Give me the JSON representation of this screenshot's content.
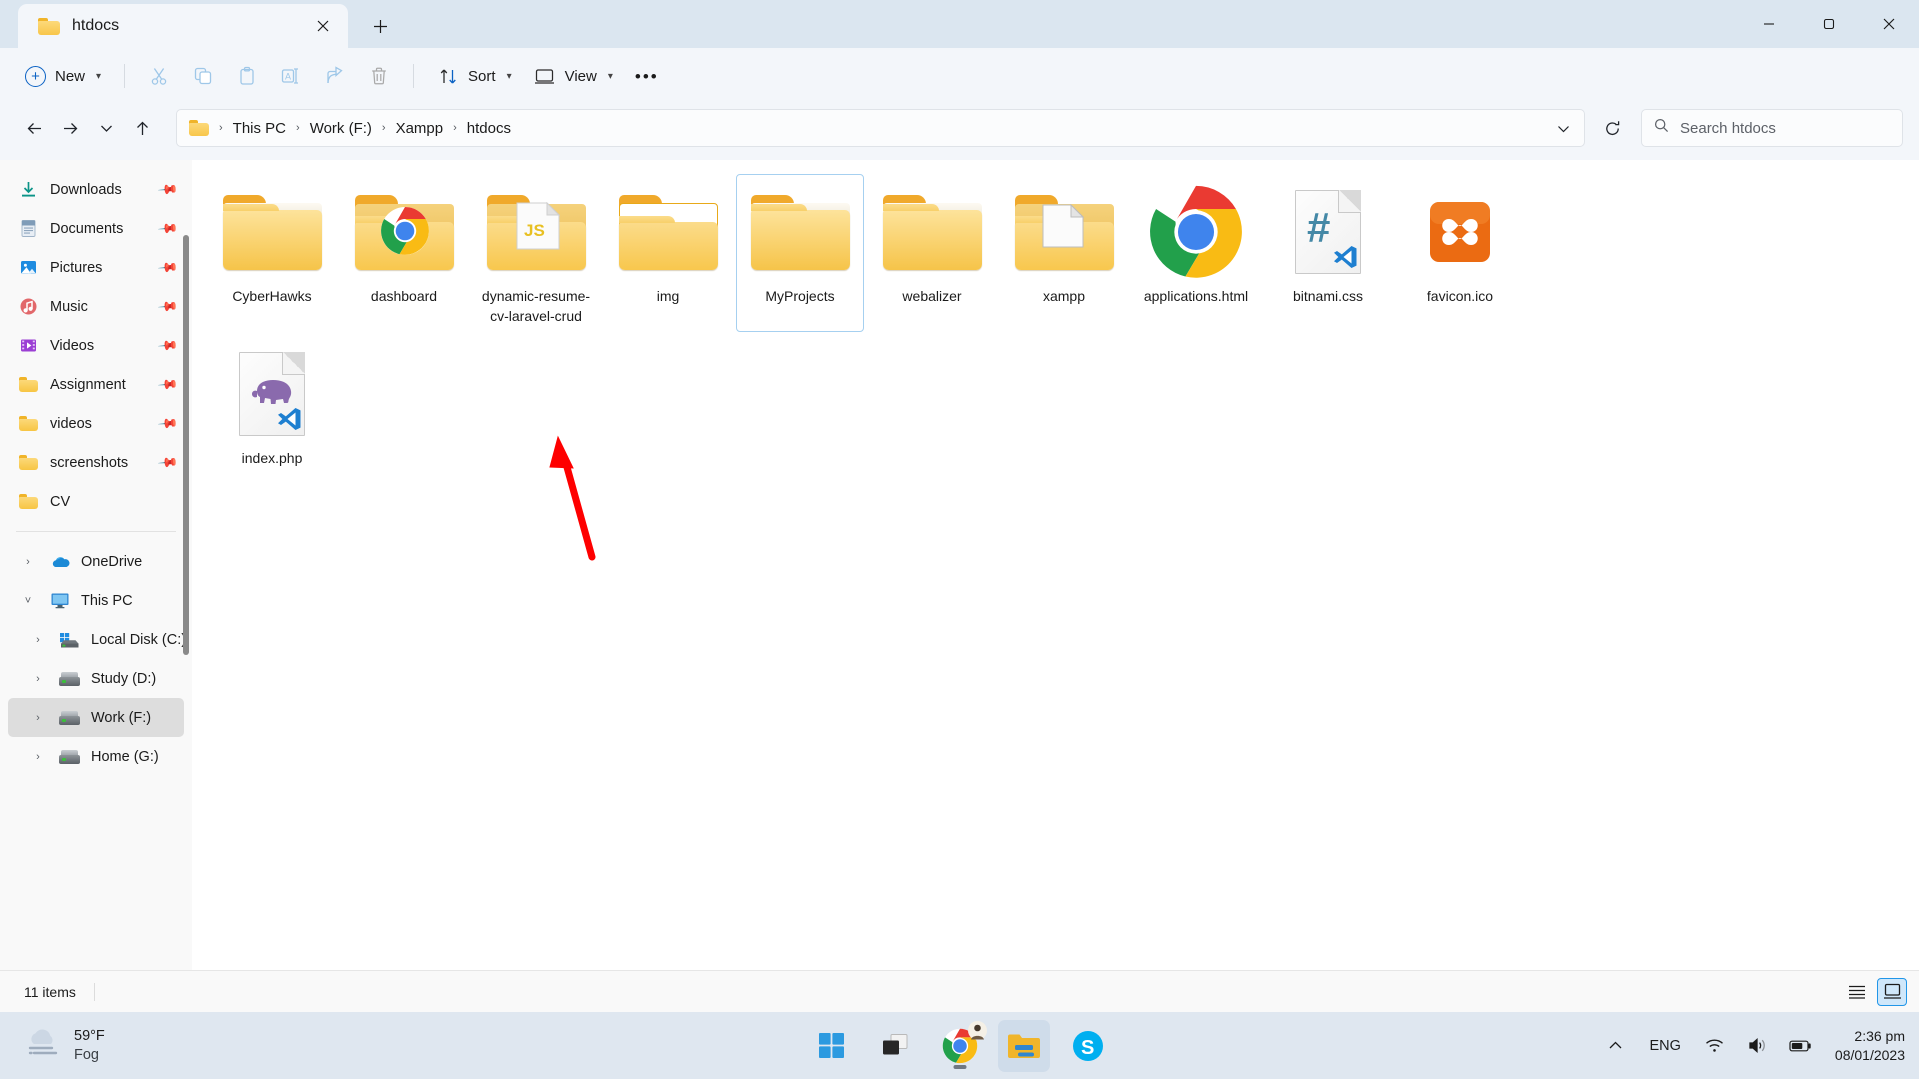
{
  "window": {
    "tab": {
      "title": "htdocs",
      "close_label": "✕",
      "folder_icon": "folder-icon"
    },
    "new_tab_label": "+",
    "caption": {
      "minimize": "minimize-button",
      "maximize": "maximize-button",
      "close": "close-button"
    }
  },
  "toolbar": {
    "new_label": "New",
    "new_plus": "+",
    "cut_label": "cut-icon",
    "copy_label": "copy-icon",
    "paste_label": "paste-icon",
    "rename_label": "rename-icon",
    "share_label": "share-icon",
    "delete_label": "delete-icon",
    "sort_label": "Sort",
    "view_label": "View",
    "more_label": "•••",
    "chevron": "˅"
  },
  "addressbar": {
    "back": "←",
    "forward": "→",
    "recent": "˅",
    "up": "↑",
    "breadcrumbs": [
      "This PC",
      "Work (F:)",
      "Xampp",
      "htdocs"
    ],
    "separator": "›",
    "dropdown": "˅",
    "refresh": "↻"
  },
  "search": {
    "placeholder": "Search htdocs",
    "icon": "search-icon"
  },
  "sidebar": {
    "quick_access": [
      {
        "label": "Downloads",
        "icon": "downloads-icon",
        "pinned": true
      },
      {
        "label": "Documents",
        "icon": "documents-icon",
        "pinned": true
      },
      {
        "label": "Pictures",
        "icon": "pictures-icon",
        "pinned": true
      },
      {
        "label": "Music",
        "icon": "music-icon",
        "pinned": true
      },
      {
        "label": "Videos",
        "icon": "videos-icon",
        "pinned": true
      },
      {
        "label": "Assignment",
        "icon": "folder-icon",
        "pinned": true
      },
      {
        "label": "videos",
        "icon": "folder-icon",
        "pinned": true
      },
      {
        "label": "screenshots",
        "icon": "folder-icon",
        "pinned": true
      },
      {
        "label": "CV",
        "icon": "folder-icon",
        "pinned": false
      }
    ],
    "tree": [
      {
        "label": "OneDrive",
        "icon": "onedrive-icon",
        "twisty": "›",
        "indent": false,
        "selected": false
      },
      {
        "label": "This PC",
        "icon": "this-pc-icon",
        "twisty": "˅",
        "indent": false,
        "selected": false
      },
      {
        "label": "Local Disk (C:)",
        "icon": "windows-drive-icon",
        "twisty": "›",
        "indent": true,
        "selected": false
      },
      {
        "label": "Study (D:)",
        "icon": "drive-icon",
        "twisty": "›",
        "indent": true,
        "selected": false
      },
      {
        "label": "Work (F:)",
        "icon": "drive-icon",
        "twisty": "›",
        "indent": true,
        "selected": true
      },
      {
        "label": "Home (G:)",
        "icon": "drive-icon",
        "twisty": "›",
        "indent": true,
        "selected": false
      }
    ]
  },
  "files": [
    {
      "name": "CyberHawks",
      "kind": "folder",
      "variant": "plain",
      "selected": false
    },
    {
      "name": "dashboard",
      "kind": "folder",
      "variant": "chrome",
      "selected": false
    },
    {
      "name": "dynamic-resume-cv-laravel-crud",
      "kind": "folder",
      "variant": "js",
      "selected": false
    },
    {
      "name": "img",
      "kind": "folder",
      "variant": "open",
      "selected": false
    },
    {
      "name": "MyProjects",
      "kind": "folder",
      "variant": "plain",
      "selected": true
    },
    {
      "name": "webalizer",
      "kind": "folder",
      "variant": "plain",
      "selected": false
    },
    {
      "name": "xampp",
      "kind": "folder",
      "variant": "doc",
      "selected": false
    },
    {
      "name": "applications.html",
      "kind": "file",
      "variant": "chrome-app",
      "selected": false
    },
    {
      "name": "bitnami.css",
      "kind": "file",
      "variant": "css",
      "selected": false
    },
    {
      "name": "favicon.ico",
      "kind": "file",
      "variant": "xampp",
      "selected": false
    },
    {
      "name": "index.php",
      "kind": "file",
      "variant": "php",
      "selected": false
    }
  ],
  "statusbar": {
    "item_count": "11 items",
    "details_view": "details-view-button",
    "large_icons_view": "large-icons-view-button"
  },
  "annotation": {
    "color": "#fe0000",
    "shape": "red-arrow"
  },
  "taskbar": {
    "weather": {
      "temperature": "59°F",
      "condition": "Fog",
      "icon": "fog-icon"
    },
    "apps": [
      {
        "name": "start-button",
        "running": false
      },
      {
        "name": "task-view-button",
        "running": false
      },
      {
        "name": "chrome-taskbar-button",
        "running": true
      },
      {
        "name": "file-explorer-taskbar-button",
        "running": true,
        "active": true
      },
      {
        "name": "skype-taskbar-button",
        "running": false
      }
    ],
    "tray": {
      "overflow": "˄",
      "language": "ENG",
      "network": "wifi-icon",
      "volume": "speaker-icon",
      "battery": "battery-icon",
      "time": "2:36 pm",
      "date": "08/01/2023"
    }
  }
}
